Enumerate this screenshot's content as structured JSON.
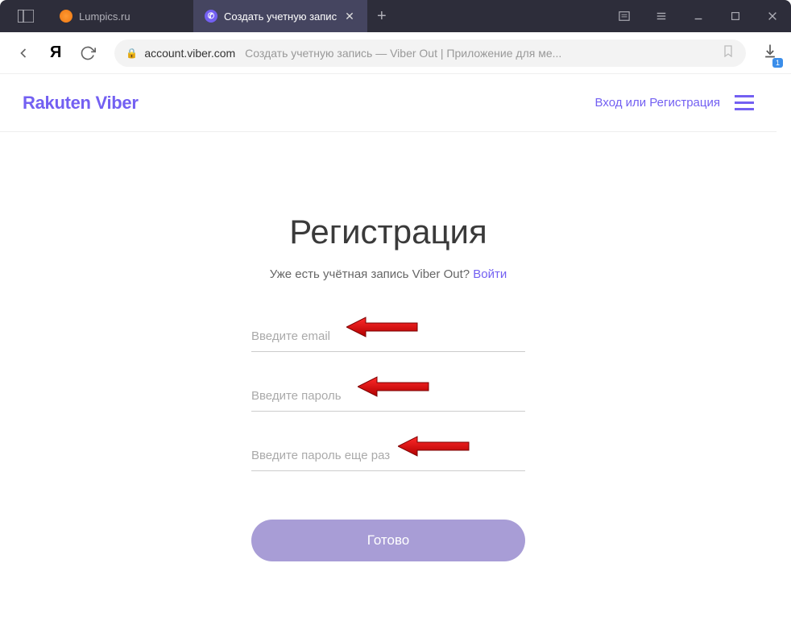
{
  "browser": {
    "tabs": [
      {
        "title": "Lumpics.ru",
        "active": false
      },
      {
        "title": "Создать учетную запис",
        "active": true
      }
    ],
    "url_domain": "account.viber.com",
    "url_title": "Создать учетную запись — Viber Out | Приложение для ме...",
    "download_badge": "1"
  },
  "header": {
    "logo": "Rakuten Viber",
    "login_link": "Вход или Регистрация"
  },
  "form": {
    "title": "Регистрация",
    "subtitle_text": "Уже есть учётная запись Viber Out? ",
    "subtitle_link": "Войти",
    "email_placeholder": "Введите email",
    "password_placeholder": "Введите пароль",
    "password2_placeholder": "Введите пароль еще раз",
    "submit_label": "Готово"
  }
}
